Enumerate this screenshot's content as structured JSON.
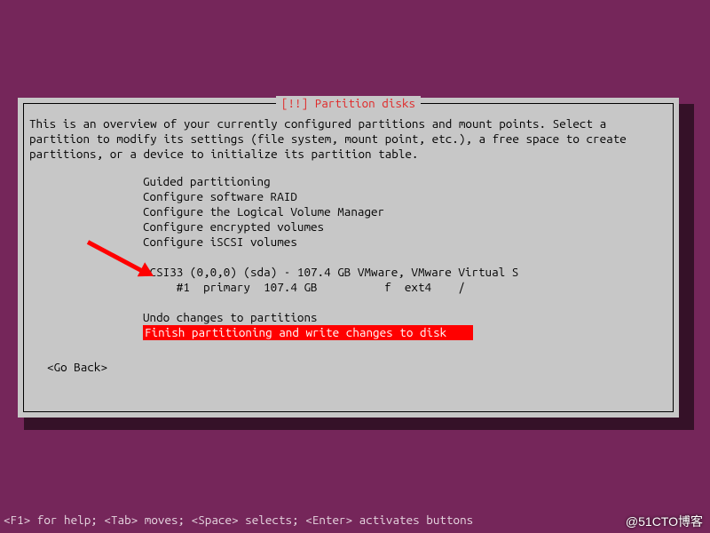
{
  "dialog": {
    "title": "[!!] Partition disks",
    "intro": "This is an overview of your currently configured partitions and mount points. Select a partition to modify its settings (file system, mount point, etc.), a free space to create partitions, or a device to initialize its partition table.",
    "menu": {
      "guided": "Guided partitioning",
      "raid": "Configure software RAID",
      "lvm": "Configure the Logical Volume Manager",
      "enc": "Configure encrypted volumes",
      "iscsi": "Configure iSCSI volumes"
    },
    "disk_header": "SCSI33 (0,0,0) (sda) - 107.4 GB VMware, VMware Virtual S",
    "partition_row": "     #1  primary  107.4 GB          f  ext4    /",
    "undo": "Undo changes to partitions",
    "finish": "Finish partitioning and write changes to disk",
    "go_back": "<Go Back>"
  },
  "hint_bar": "<F1> for help; <Tab> moves; <Space> selects; <Enter> activates buttons",
  "watermark": "@51CTO博客"
}
